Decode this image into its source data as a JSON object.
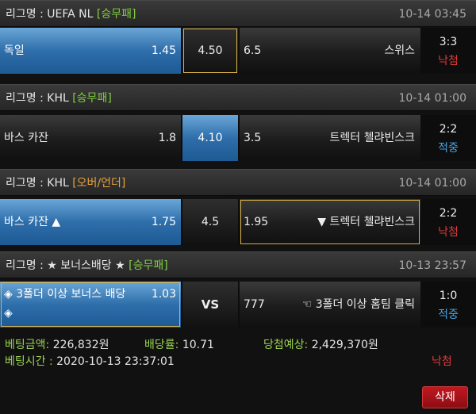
{
  "bets": [
    {
      "league": "리그명 : UEFA NL",
      "type": "[승무패]",
      "time": "10-14 03:45",
      "home": "독일",
      "home_odds": "1.45",
      "draw": "4.50",
      "away_odds": "6.5",
      "away": "스위스",
      "score": "3:3",
      "status": "낙첨"
    },
    {
      "league": "리그명 : KHL",
      "type": "[승무패]",
      "time": "10-14 01:00",
      "home": "바스 카잔",
      "home_odds": "1.8",
      "draw": "4.10",
      "away_odds": "3.5",
      "away": "트렉터 첼랴빈스크",
      "score": "2:2",
      "status": "적중"
    },
    {
      "league": "리그명 : KHL",
      "type": "[오버/언더]",
      "time": "10-14 01:00",
      "home": "바스 카잔 ▲",
      "home_odds": "1.75",
      "draw": "4.5",
      "away_odds": "1.95",
      "away": "▼ 트렉터 첼랴빈스크",
      "score": "2:2",
      "status": "낙첨"
    },
    {
      "league": "리그명 : ★ 보너스배당 ★",
      "type": "[승무패]",
      "time": "10-13 23:57",
      "home": "◈ 3폴더 이상 보너스 배당",
      "home_line2": "◈",
      "home_odds": "1.03",
      "draw": "VS",
      "away_odds": "777",
      "away": "☜ 3폴더 이상 홈팀 클릭",
      "score": "1:0",
      "status": "적중"
    }
  ],
  "summary": {
    "amount_label": "베팅금액:",
    "amount": "226,832원",
    "rate_label": "배당률:",
    "rate": "10.71",
    "expected_label": "당첨예상:",
    "expected": "2,429,370원",
    "time_label": "베팅시간 :",
    "time": "2020-10-13 23:37:01",
    "result": "낙첨",
    "delete_label": "삭제"
  },
  "colors": {
    "selected": "#2e6eaa",
    "tag_green": "#7fcf3f",
    "tag_orange": "#e8a33a",
    "lose": "#e0393a",
    "win": "#48a3e0",
    "delete": "#b3141c"
  }
}
